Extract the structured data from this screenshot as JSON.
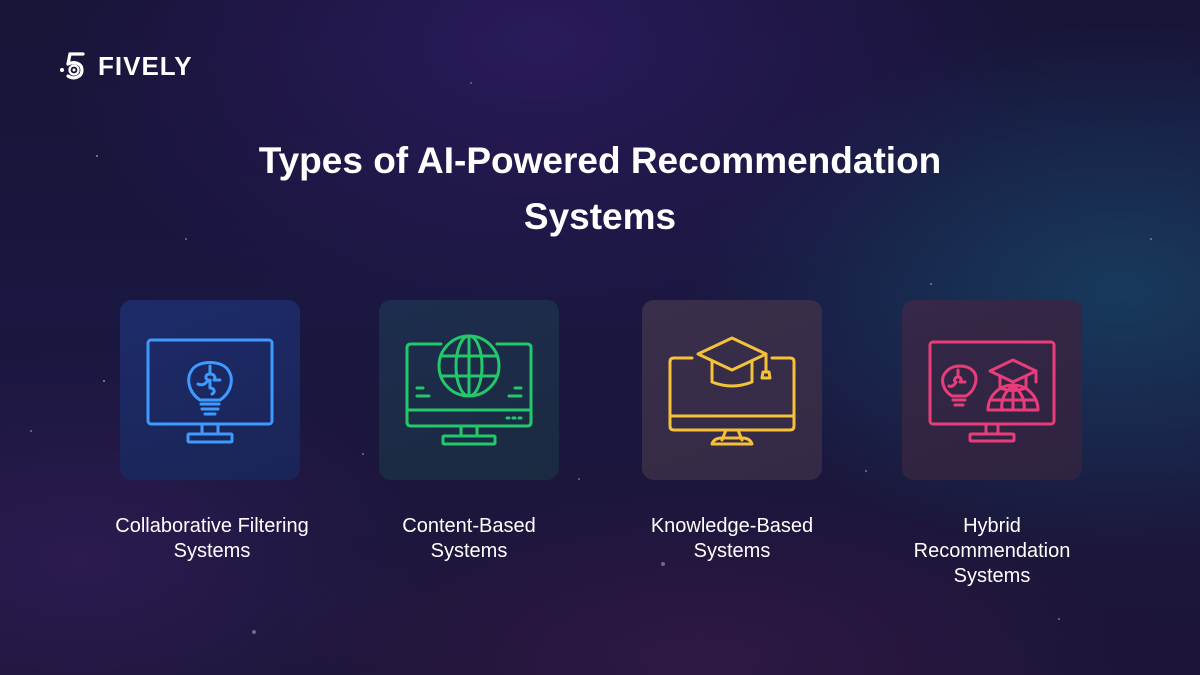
{
  "brand": {
    "name": "FIVELY",
    "icon": "fively-5-logo-icon"
  },
  "title": {
    "line1": "Types of AI-Powered Recommendation",
    "line2": "Systems"
  },
  "cards": [
    {
      "line1": "Collaborative Filtering",
      "line2": "Systems",
      "line3": "",
      "icon": "monitor-lightbulb-puzzle-icon",
      "color": "#3d9bff"
    },
    {
      "line1": "Content-Based",
      "line2": "Systems",
      "line3": "",
      "icon": "monitor-globe-icon",
      "color": "#22c86a"
    },
    {
      "line1": "Knowledge-Based",
      "line2": "Systems",
      "line3": "",
      "icon": "monitor-graduation-cap-icon",
      "color": "#f5c03a"
    },
    {
      "line1": "Hybrid",
      "line2": "Recommendation",
      "line3": "Systems",
      "icon": "monitor-bulb-cap-globe-icon",
      "color": "#e83d7a"
    }
  ]
}
